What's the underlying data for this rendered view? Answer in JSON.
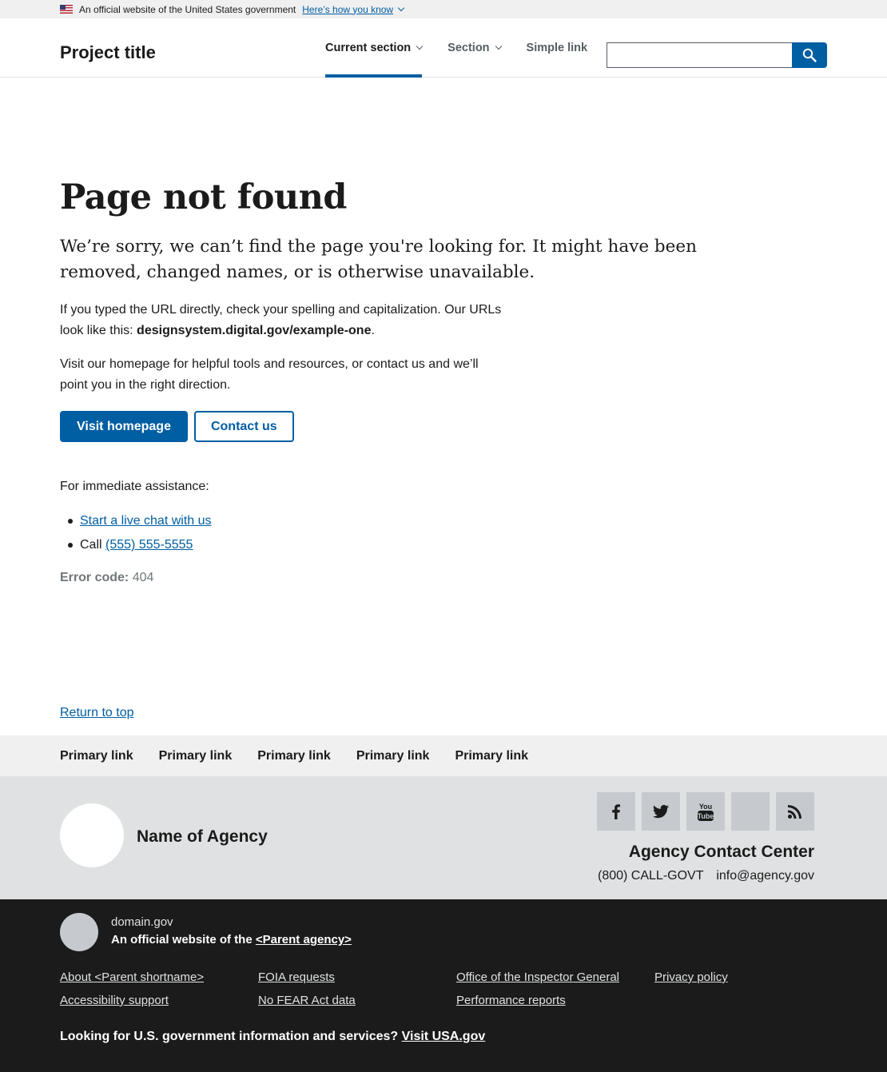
{
  "banner": {
    "text": "An official website of the United States government",
    "link": "Here’s how you know"
  },
  "header": {
    "title": "Project title",
    "nav": [
      {
        "label": "Current section"
      },
      {
        "label": "Section"
      },
      {
        "label": "Simple link"
      }
    ],
    "search_value": ""
  },
  "main": {
    "heading": "Page not found",
    "lead": "We’re sorry, we can’t find the page you're looking for. It might have been removed, changed names, or is otherwise unavailable.",
    "p1_text": "If you typed the URL directly, check your spelling and capitalization. Our URLs look like this: ",
    "p1_url": "designsystem.digital.gov/example-one",
    "p1_end": ".",
    "p2": "Visit our homepage for helpful tools and resources, or contact us and we’ll point you in the right direction.",
    "primary_button": "Visit homepage",
    "secondary_button": "Contact us",
    "assist_intro": "For immediate assistance:",
    "chat_link": "Start a live chat with us",
    "call_prefix": "Call ",
    "call_number": "(555) 555-5555",
    "error_label": "Error code:",
    "error_value": "404"
  },
  "return_to_top": "Return to top",
  "footer_primary": [
    "Primary link",
    "Primary link",
    "Primary link",
    "Primary link",
    "Primary link"
  ],
  "footer_secondary": {
    "agency_name": "Name of Agency",
    "socials": [
      "facebook-icon",
      "twitter-icon",
      "youtube-icon",
      "blank-icon",
      "rss-icon"
    ],
    "contact_heading": "Agency Contact Center",
    "phone": "(800) CALL-GOVT",
    "email": "info@agency.gov"
  },
  "identifier": {
    "domain": "domain.gov",
    "official_prefix": "An official website of the ",
    "parent_agency": "<Parent agency>",
    "links": [
      "About <Parent shortname>",
      "FOIA requests",
      "Office of the Inspector General",
      "Privacy policy",
      "Accessibility support",
      "No FEAR Act data",
      "Performance reports"
    ],
    "usa_text": "Looking for U.S. government information and services? ",
    "usa_link": "Visit USA.gov"
  },
  "colors": {
    "primary": "#005ea2",
    "dark": "#1b1b1b",
    "gray_bg": "#f0f0f0"
  }
}
